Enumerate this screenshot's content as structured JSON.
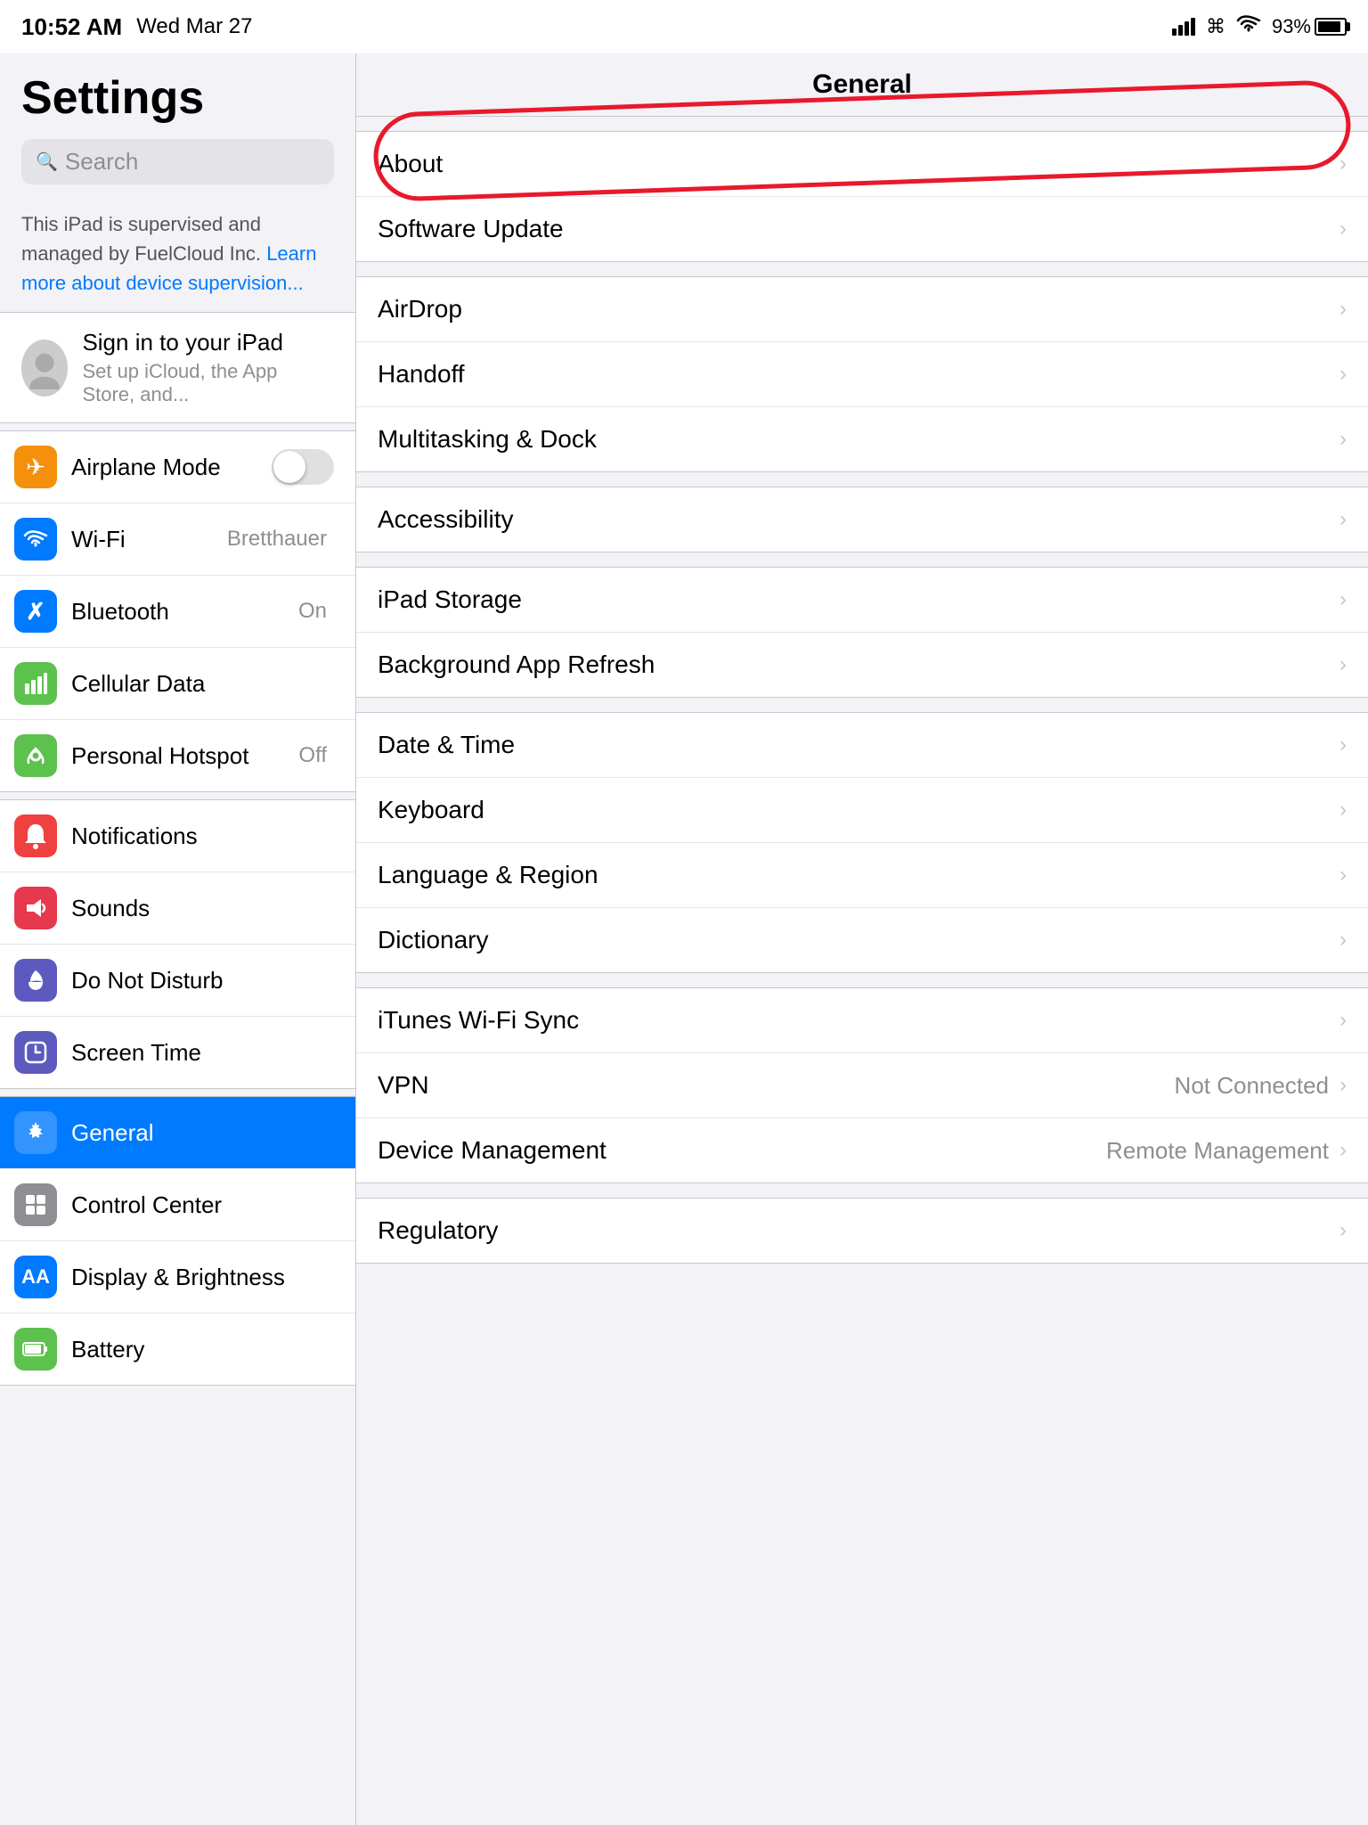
{
  "statusBar": {
    "time": "10:52 AM",
    "date": "Wed Mar 27",
    "battery": "93%"
  },
  "sidebar": {
    "title": "Settings",
    "search": {
      "placeholder": "Search"
    },
    "supervisionNotice": {
      "text": "This iPad is supervised and managed by FuelCloud Inc.",
      "linkText": "Learn more about device supervision..."
    },
    "signIn": {
      "title": "Sign in to your iPad",
      "subtitle": "Set up iCloud, the App Store, and..."
    },
    "networkItems": [
      {
        "id": "airplane-mode",
        "label": "Airplane Mode",
        "iconBg": "#f4900c",
        "hasToggle": true
      },
      {
        "id": "wifi",
        "label": "Wi-Fi",
        "value": "Bretthauer",
        "iconBg": "#007aff"
      },
      {
        "id": "bluetooth",
        "label": "Bluetooth",
        "value": "On",
        "iconBg": "#007aff"
      },
      {
        "id": "cellular",
        "label": "Cellular Data",
        "iconBg": "#5dc14e"
      },
      {
        "id": "hotspot",
        "label": "Personal Hotspot",
        "value": "Off",
        "iconBg": "#5dc14e"
      }
    ],
    "notificationItems": [
      {
        "id": "notifications",
        "label": "Notifications",
        "iconBg": "#f04141"
      },
      {
        "id": "sounds",
        "label": "Sounds",
        "iconBg": "#e6394e"
      },
      {
        "id": "donotdisturb",
        "label": "Do Not Disturb",
        "iconBg": "#5c5abf"
      },
      {
        "id": "screentime",
        "label": "Screen Time",
        "iconBg": "#5c5abf"
      }
    ],
    "mainItems": [
      {
        "id": "general",
        "label": "General",
        "iconBg": "#8e8e93",
        "selected": true
      },
      {
        "id": "controlcenter",
        "label": "Control Center",
        "iconBg": "#8e8e93"
      },
      {
        "id": "displaybrightness",
        "label": "Display & Brightness",
        "iconBg": "#007aff"
      },
      {
        "id": "battery",
        "label": "Battery",
        "iconBg": "#5dc14e"
      }
    ]
  },
  "rightPanel": {
    "title": "General",
    "groups": [
      {
        "id": "group1",
        "items": [
          {
            "id": "about",
            "label": "About",
            "hasAnnotation": true
          },
          {
            "id": "softwareupdate",
            "label": "Software Update"
          }
        ]
      },
      {
        "id": "group2",
        "items": [
          {
            "id": "airdrop",
            "label": "AirDrop"
          },
          {
            "id": "handoff",
            "label": "Handoff"
          },
          {
            "id": "multitasking",
            "label": "Multitasking & Dock"
          }
        ]
      },
      {
        "id": "group3",
        "items": [
          {
            "id": "accessibility",
            "label": "Accessibility"
          }
        ]
      },
      {
        "id": "group4",
        "items": [
          {
            "id": "ipadstorage",
            "label": "iPad Storage"
          },
          {
            "id": "backgroundapp",
            "label": "Background App Refresh"
          }
        ]
      },
      {
        "id": "group5",
        "items": [
          {
            "id": "datetime",
            "label": "Date & Time"
          },
          {
            "id": "keyboard",
            "label": "Keyboard"
          },
          {
            "id": "language",
            "label": "Language & Region"
          },
          {
            "id": "dictionary",
            "label": "Dictionary"
          }
        ]
      },
      {
        "id": "group6",
        "items": [
          {
            "id": "ituneswifi",
            "label": "iTunes Wi-Fi Sync"
          },
          {
            "id": "vpn",
            "label": "VPN",
            "value": "Not Connected"
          },
          {
            "id": "devicemanagement",
            "label": "Device Management",
            "value": "Remote Management"
          }
        ]
      },
      {
        "id": "group7",
        "items": [
          {
            "id": "regulatory",
            "label": "Regulatory"
          }
        ]
      }
    ]
  },
  "icons": {
    "airplane": "✈",
    "wifi": "📶",
    "bluetooth": "🔷",
    "cellular": "📡",
    "hotspot": "🔗",
    "notifications": "🔔",
    "sounds": "🔊",
    "donotdisturb": "🌙",
    "screentime": "⏱",
    "general": "⚙️",
    "controlcenter": "⊞",
    "display": "AA",
    "battery": "🔋"
  }
}
